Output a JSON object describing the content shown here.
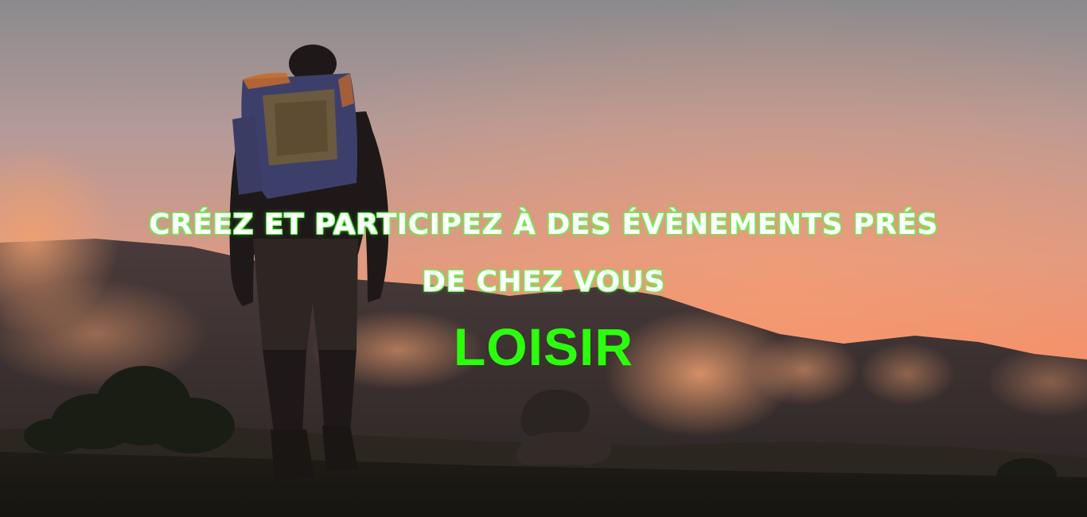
{
  "hero": {
    "headline_line_1": "CRÉEZ ET PARTICIPEZ À DES ÉVÈNEMENTS PRÉS",
    "headline_line_2": "DE CHEZ VOUS",
    "category": "LOISIR"
  },
  "colors": {
    "headline_text": "#ffffff",
    "headline_outline": "#5cff4a",
    "category_text": "#2bff0d",
    "sky_top": "#8f8c8e",
    "sky_bottom": "#f08e6a"
  }
}
